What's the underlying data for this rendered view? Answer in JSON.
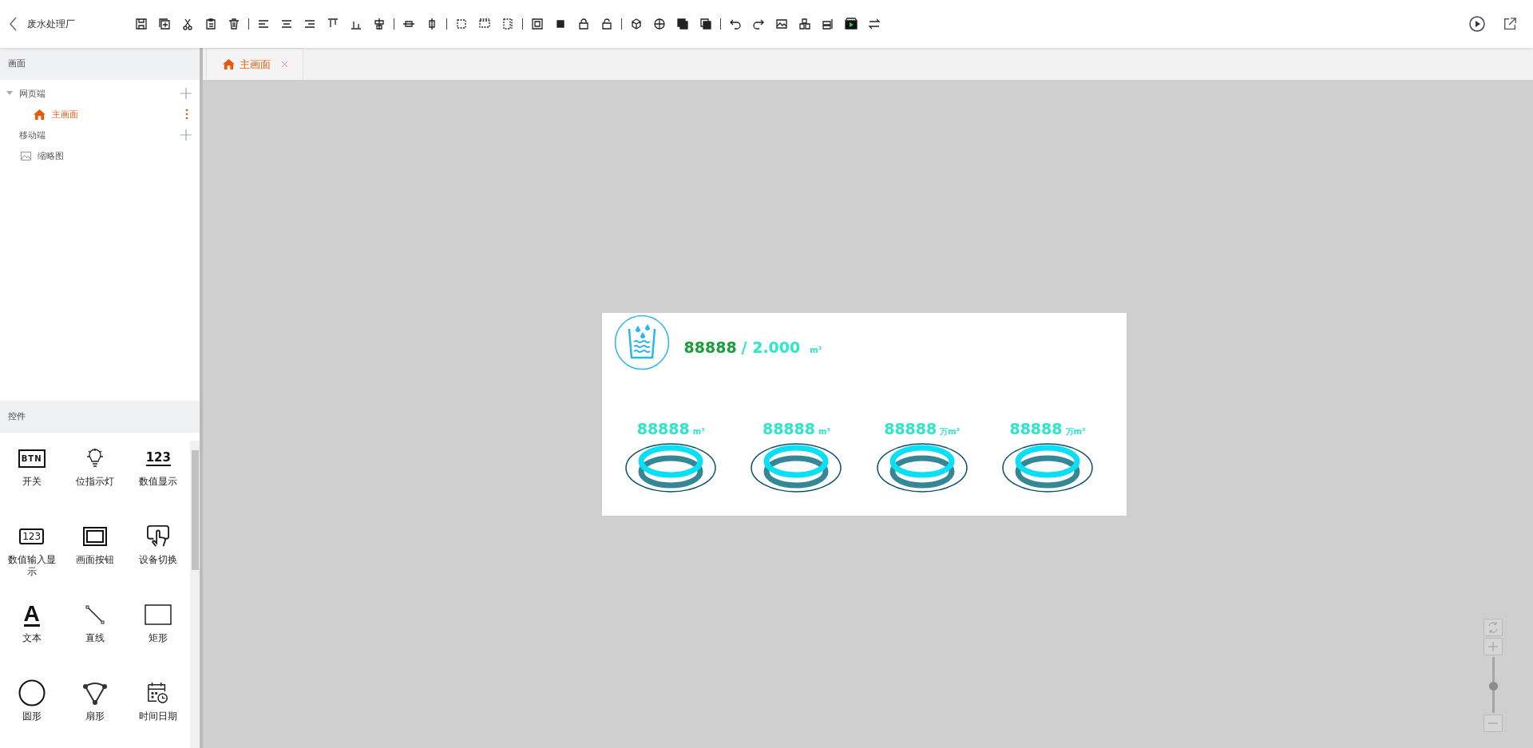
{
  "app": {
    "title": "废水处理厂"
  },
  "sidebar": {
    "pages_header": "画面",
    "tree": [
      {
        "label": "网页端",
        "kind": "group",
        "expanded": true,
        "children": [
          {
            "label": "主画面",
            "selected": true
          }
        ]
      },
      {
        "label": "移动端",
        "kind": "group",
        "expanded": false
      },
      {
        "label": "缩略图",
        "kind": "thumbnail"
      }
    ],
    "controls_header": "控件",
    "controls": [
      {
        "label": "开关",
        "icon_text": "BTN"
      },
      {
        "label": "位指示灯"
      },
      {
        "label": "数值显示",
        "icon_text": "123"
      },
      {
        "label": "数值输入显示",
        "icon_text": "123"
      },
      {
        "label": "画面按钮"
      },
      {
        "label": "设备切换"
      },
      {
        "label": "文本",
        "icon_text": "A"
      },
      {
        "label": "直线"
      },
      {
        "label": "矩形"
      },
      {
        "label": "圆形"
      },
      {
        "label": "扇形"
      },
      {
        "label": "时间日期"
      }
    ]
  },
  "tabs": [
    {
      "label": "主画面",
      "selected": true
    }
  ],
  "canvas": {
    "total": {
      "value": "88888",
      "capacity": "/ 2.000",
      "unit": "m³"
    },
    "gauges": [
      {
        "value": "88888",
        "unit": "m³"
      },
      {
        "value": "88888",
        "unit": "m³"
      },
      {
        "value": "88888",
        "unit": "万m³"
      },
      {
        "value": "88888",
        "unit": "万m³"
      }
    ]
  },
  "zoom": {
    "level": 0.47
  }
}
